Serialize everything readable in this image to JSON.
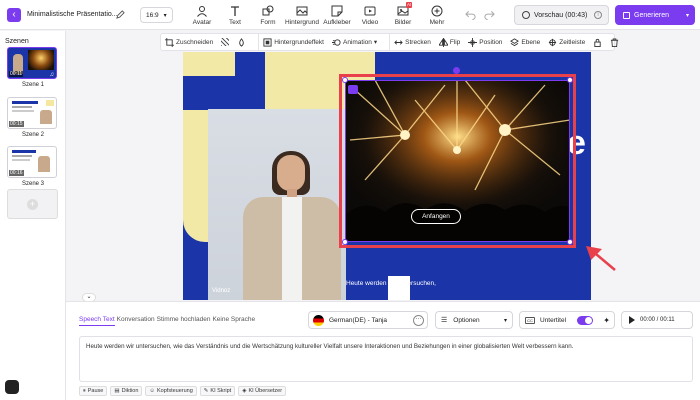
{
  "header": {
    "project_title": "Minimalistische Präsentatio...",
    "aspect_ratio": "16:9",
    "tools": [
      {
        "label": "Avatar",
        "icon": "avatar-icon"
      },
      {
        "label": "Text",
        "icon": "text-icon"
      },
      {
        "label": "Form",
        "icon": "shape-icon"
      },
      {
        "label": "Hintergrund",
        "icon": "background-icon"
      },
      {
        "label": "Aufkleber",
        "icon": "sticker-icon"
      },
      {
        "label": "Video",
        "icon": "video-icon"
      },
      {
        "label": "Bilder",
        "icon": "image-icon",
        "badge": "AI"
      },
      {
        "label": "Mehr",
        "icon": "more-icon"
      }
    ],
    "preview_label": "Vorschau (00:43)",
    "generate_label": "Generieren",
    "accent": "#7b3cf0"
  },
  "sidebar": {
    "title": "Szenen",
    "scenes": [
      {
        "label": "Szene 1",
        "time": "00:11"
      },
      {
        "label": "Szene 2",
        "time": "00:15"
      },
      {
        "label": "Szene 3",
        "time": "00:16"
      }
    ]
  },
  "context_toolbar": {
    "crop": "Zuschneiden",
    "background_effect": "Hintergrundeffekt",
    "animation": "Animation",
    "stretch": "Strecken",
    "flip": "Flip",
    "position": "Position",
    "layer": "Ebene",
    "timeline": "Zeitleiste"
  },
  "canvas": {
    "video_button": "Anfangen",
    "subtitle": "Heute werden wir untersuchen,",
    "watermark": "Vidnoz",
    "background_letter": "e"
  },
  "speech": {
    "tabs": [
      "Speech Text",
      "Konversation",
      "Stimme hochladen",
      "Keine Sprache"
    ],
    "voice": "German(DE) - Tanja",
    "options_label": "Optionen",
    "subtitle_label": "Untertitel",
    "subtitle_on": true,
    "time": "00:00 / 00:11",
    "script_text": "Heute werden wir untersuchen, wie das Verständnis und die Wertschätzung kultureller Vielfalt unsere Interaktionen und Beziehungen in einer globalisierten Welt verbessern kann.",
    "footer_buttons": [
      "Pause",
      "Diktion",
      "Kopfsteuerung",
      "KI Skript",
      "KI Übersetzer"
    ]
  }
}
